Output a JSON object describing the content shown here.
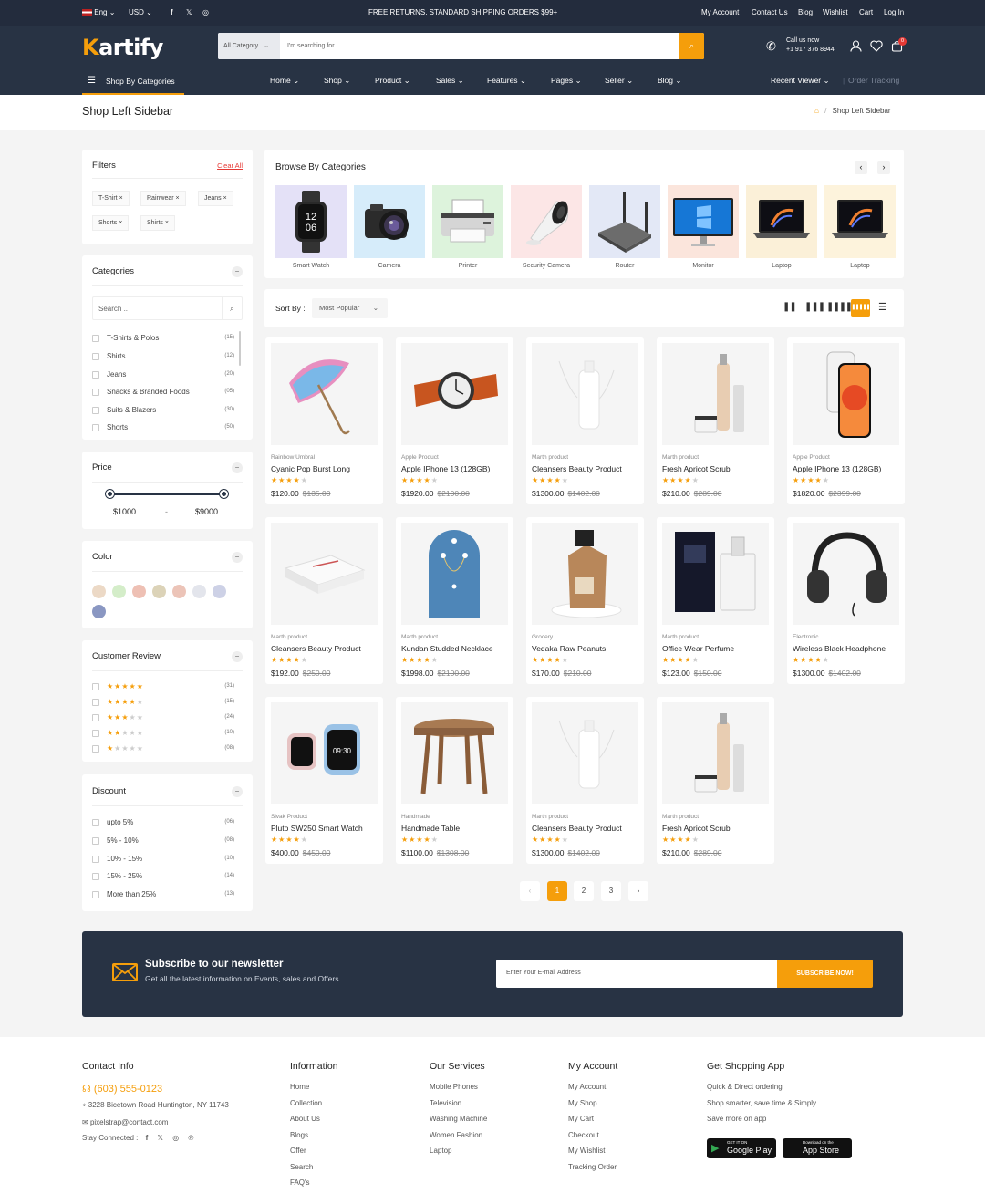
{
  "topbar": {
    "lang": "Eng",
    "currency": "USD",
    "promo": "FREE RETURNS. STANDARD SHIPPING ORDERS $99+",
    "links": [
      "My Account",
      "Contact Us",
      "Blog",
      "Wishlist",
      "Cart",
      "Log In"
    ]
  },
  "header": {
    "logo_first": "K",
    "logo_rest": "artify",
    "search_category": "All Category",
    "search_placeholder": "I'm searching for...",
    "call_label": "Call us now",
    "call_number": "+1 917 376 8944",
    "cart_count": "0",
    "shop_by_categories": "Shop By Categories",
    "nav": [
      "Home",
      "Shop",
      "Product",
      "Sales",
      "Features",
      "Pages",
      "Seller",
      "Blog"
    ],
    "recent_viewer": "Recent Viewer",
    "order_tracking": "Order Tracking"
  },
  "breadcrumb": {
    "title": "Shop Left Sidebar",
    "current": "Shop Left Sidebar"
  },
  "filters": {
    "title": "Filters",
    "clear": "Clear All",
    "chips": [
      "T-Shirt",
      "Rainwear",
      "Jeans",
      "Shorts",
      "Shirts"
    ]
  },
  "categories": {
    "title": "Categories",
    "search_placeholder": "Search ..",
    "items": [
      {
        "label": "T-Shirts & Polos",
        "count": "(15)"
      },
      {
        "label": "Shirts",
        "count": "(12)"
      },
      {
        "label": "Jeans",
        "count": "(20)"
      },
      {
        "label": "Snacks & Branded Foods",
        "count": "(05)"
      },
      {
        "label": "Suits & Blazers",
        "count": "(30)"
      },
      {
        "label": "Shorts",
        "count": "(50)"
      }
    ]
  },
  "price": {
    "title": "Price",
    "min": "$1000",
    "sep": "-",
    "max": "$9000"
  },
  "color": {
    "title": "Color",
    "swatches": [
      "#ecd9c6",
      "#d4edc9",
      "#eec0b4",
      "#dcd3b8",
      "#ecc4b8",
      "#e3e5ec",
      "#cdd1e6",
      "#8a97c2"
    ]
  },
  "review": {
    "title": "Customer Review",
    "rows": [
      {
        "stars": 5,
        "count": "(31)"
      },
      {
        "stars": 4,
        "count": "(15)"
      },
      {
        "stars": 3,
        "count": "(24)"
      },
      {
        "stars": 2,
        "count": "(10)"
      },
      {
        "stars": 1,
        "count": "(08)"
      }
    ]
  },
  "discount": {
    "title": "Discount",
    "items": [
      {
        "label": "upto 5%",
        "count": "(06)"
      },
      {
        "label": "5% - 10%",
        "count": "(08)"
      },
      {
        "label": "10% - 15%",
        "count": "(10)"
      },
      {
        "label": "15% - 25%",
        "count": "(14)"
      },
      {
        "label": "More than 25%",
        "count": "(13)"
      }
    ]
  },
  "browse": {
    "title": "Browse By Categories",
    "categories": [
      {
        "label": "Smart Watch",
        "bg": "#e4e1f7"
      },
      {
        "label": "Camera",
        "bg": "#d6ecfa"
      },
      {
        "label": "Printer",
        "bg": "#ddf3dc"
      },
      {
        "label": "Security Camera",
        "bg": "#fce6e6"
      },
      {
        "label": "Router",
        "bg": "#e3e8f6"
      },
      {
        "label": "Monitor",
        "bg": "#fbe5dc"
      },
      {
        "label": "Laptop",
        "bg": "#fbf0d8"
      },
      {
        "label": "Laptop",
        "bg": "#fdf3dc"
      }
    ]
  },
  "sort": {
    "label": "Sort By :",
    "value": "Most Popular"
  },
  "products": [
    {
      "brand": "Rainbow Umbral",
      "name": "Cyanic Pop Burst Long",
      "stars": 4,
      "price": "$120.00",
      "old": "$135.00"
    },
    {
      "brand": "Apple Product",
      "name": "Apple IPhone 13 (128GB)",
      "stars": 4,
      "price": "$1920.00",
      "old": "$2100.00"
    },
    {
      "brand": "Marth product",
      "name": "Cleansers Beauty Product",
      "stars": 4,
      "price": "$1300.00",
      "old": "$1402.00"
    },
    {
      "brand": "Marth product",
      "name": "Fresh Apricot Scrub",
      "stars": 4,
      "price": "$210.00",
      "old": "$289.00"
    },
    {
      "brand": "Apple Product",
      "name": "Apple IPhone 13 (128GB)",
      "stars": 4,
      "price": "$1820.00",
      "old": "$2399.00"
    },
    {
      "brand": "Marth product",
      "name": "Cleansers Beauty Product",
      "stars": 4,
      "price": "$192.00",
      "old": "$250.00"
    },
    {
      "brand": "Marth product",
      "name": "Kundan Studded Necklace",
      "stars": 4,
      "price": "$1998.00",
      "old": "$2100.00"
    },
    {
      "brand": "Grocery",
      "name": "Vedaka Raw Peanuts",
      "stars": 4,
      "price": "$170.00",
      "old": "$210.00"
    },
    {
      "brand": "Marth product",
      "name": "Office Wear Perfume",
      "stars": 4,
      "price": "$123.00",
      "old": "$150.00"
    },
    {
      "brand": "Electronic",
      "name": "Wireless Black Headphone",
      "stars": 4,
      "price": "$1300.00",
      "old": "$1402.00"
    },
    {
      "brand": "Sivak Product",
      "name": "Pluto SW250 Smart Watch",
      "stars": 4,
      "price": "$400.00",
      "old": "$450.00"
    },
    {
      "brand": "Handmade",
      "name": "Handmade Table",
      "stars": 4,
      "price": "$1100.00",
      "old": "$1308.00"
    },
    {
      "brand": "Marth product",
      "name": "Cleansers Beauty Product",
      "stars": 4,
      "price": "$1300.00",
      "old": "$1402.00"
    },
    {
      "brand": "Marth product",
      "name": "Fresh Apricot Scrub",
      "stars": 4,
      "price": "$210.00",
      "old": "$289.00"
    }
  ],
  "pagination": {
    "prev": "‹",
    "pages": [
      "1",
      "2",
      "3"
    ],
    "next": "›",
    "active": "1"
  },
  "newsletter": {
    "title": "Subscribe to our newsletter",
    "subtitle": "Get all the latest information on Events, sales and Offers",
    "placeholder": "Enter Your E-mail Address",
    "button": "SUBSCRIBE NOW!"
  },
  "footer": {
    "contact": {
      "title": "Contact Info",
      "phone": "(603) 555-0123",
      "address": "3228 Bicetown Road Huntington, NY 11743",
      "email": "pixelstrap@contact.com",
      "stay": "Stay Connected :"
    },
    "information": {
      "title": "Information",
      "links": [
        "Home",
        "Collection",
        "About Us",
        "Blogs",
        "Offer",
        "Search",
        "FAQ's"
      ]
    },
    "services": {
      "title": "Our Services",
      "links": [
        "Mobile Phones",
        "Television",
        "Washing Machine",
        "Women Fashion",
        "Laptop"
      ]
    },
    "account": {
      "title": "My Account",
      "links": [
        "My Account",
        "My Shop",
        "My Cart",
        "Checkout",
        "My Wishlist",
        "Tracking Order"
      ]
    },
    "app": {
      "title": "Get Shopping App",
      "lines": [
        "Quick & Direct ordering",
        "Shop smarter, save time & Simply",
        "Save more on app"
      ],
      "google_small": "GET IT ON",
      "google_big": "Google Play",
      "apple_small": "Download on the",
      "apple_big": "App Store"
    }
  },
  "colors": {
    "accent": "#f59e0b",
    "header": "#283344",
    "topbar": "#232c3d"
  }
}
